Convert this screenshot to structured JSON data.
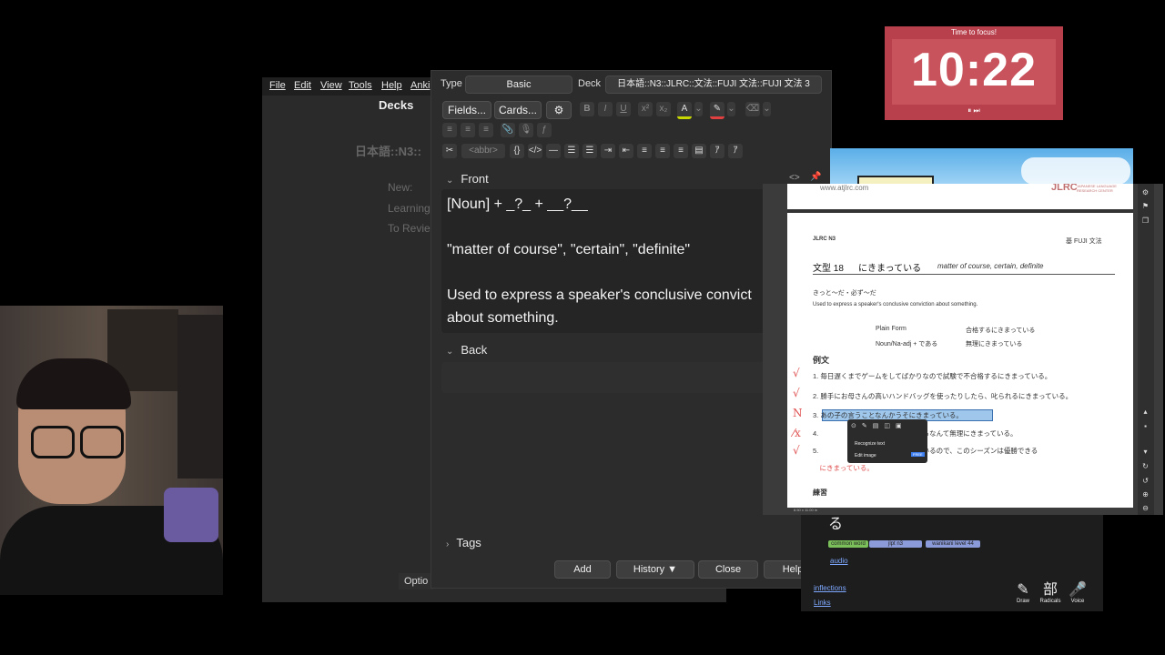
{
  "anki_main": {
    "menu": [
      "File",
      "Edit",
      "View",
      "Tools",
      "Help",
      "Anki"
    ],
    "decks_title": "Decks",
    "deck_name": "日本語::N3::",
    "stats": [
      "New:",
      "Learning:",
      "To Revie"
    ],
    "options_label": "Optio"
  },
  "add_window": {
    "type_label": "Type",
    "type_value": "Basic",
    "deck_label": "Deck",
    "deck_value": "日本語::N3::JLRC::文法::FUJI 文法::FUJI 文法 3",
    "fields_button": "Fields...",
    "cards_button": "Cards...",
    "toolbar_abbr": "<abbr>",
    "front_label": "Front",
    "front_lines": [
      "[Noun] + _?_ + __?__",
      "\"matter of course\", \"certain\", \"definite\"",
      "Used to express a speaker's conclusive convict",
      "about something."
    ],
    "back_label": "Back",
    "tags_label": "Tags",
    "buttons": {
      "add": "Add",
      "history": "History ▼",
      "close": "Close",
      "help": "Help"
    }
  },
  "timer": {
    "label": "Time to focus!",
    "time": "10:22",
    "controls": "⏸ ⏭",
    "accent": "#b8404c"
  },
  "wanikani": {
    "kana": "る",
    "tags": [
      "common word",
      "jlpt n3",
      "wanikani level 44"
    ],
    "links": [
      "audio",
      "inflections",
      "Links"
    ],
    "tools": [
      {
        "glyph": "✎",
        "label": "Draw"
      },
      {
        "glyph": "部",
        "label": "Radicals"
      },
      {
        "glyph": "🎤",
        "label": "Voice"
      }
    ]
  },
  "pdf": {
    "site": "www.atjlrc.com",
    "org": "JLRC",
    "org_sub": "JAPANESE LANGUAGE RESEARCH CENTER",
    "level": "JLRC N3",
    "book": "基 FUJI 文法",
    "pattern_no": "文型 18",
    "pattern": "にきまっている",
    "meaning": "matter of course, certain, definite",
    "synonyms": "きっと〜だ・必ず〜だ",
    "description": "Used to express a speaker's conclusive conviction about something.",
    "plain_form_label": "Plain Form",
    "plain_form_example": "合格するにきまっている",
    "noun_form_label": "Noun/Na-adj + である",
    "noun_form_example": "無理にきまっている",
    "examples_heading": "例文",
    "sentences": [
      "1. 毎日遅くまでゲームをしてばかりなので試験で不合格するにきまっている。",
      "2. 勝手にお母さんの高いハンドバッグを使ったりしたら、叱られるにきまっている。",
      "3. あの子の言うことなんかうそにきまっている。",
      "4. 　　　　　字を、一日で全部覚えるなんて無理にきまっている。",
      "5. 　　　　　死でトレーニングしているので、このシーズンは優勝できる",
      "　にきまっている。"
    ],
    "marks": [
      "√",
      "√",
      "N",
      "⁄x",
      "√"
    ],
    "practice_heading": "練習",
    "context_menu": [
      "Recognize text",
      "Edit image"
    ],
    "context_badge": "FREE",
    "page_size": "8.50 x 11.00 in"
  }
}
